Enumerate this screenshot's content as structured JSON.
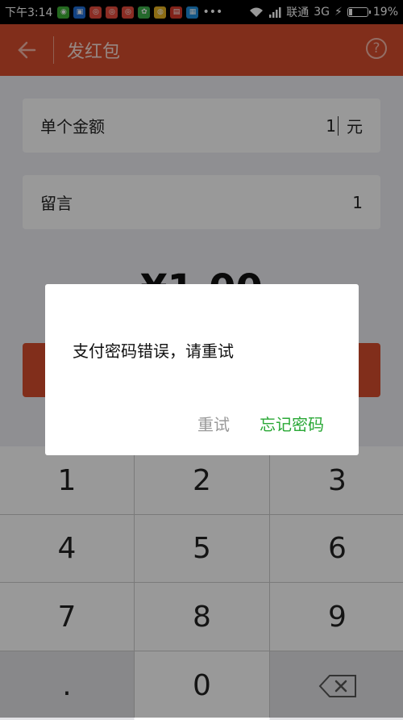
{
  "status_bar": {
    "time": "下午3:14",
    "carrier": "联通",
    "network": "3G",
    "battery": "19%",
    "battery_level": 0.19,
    "dots": "•••",
    "notification_icons": [
      {
        "name": "wechat-icon",
        "color": "#3cb034"
      },
      {
        "name": "app-icon",
        "color": "#1e6fd9"
      },
      {
        "name": "weibo-icon",
        "color": "#e84b3c"
      },
      {
        "name": "weibo-icon",
        "color": "#e84b3c"
      },
      {
        "name": "weibo-icon",
        "color": "#e84b3c"
      },
      {
        "name": "green-app-icon",
        "color": "#3db04a"
      },
      {
        "name": "chrome-icon",
        "color": "#e8b522"
      },
      {
        "name": "news-app-icon",
        "color": "#d83a2b"
      },
      {
        "name": "blue-app-icon",
        "color": "#1e8fe0"
      }
    ]
  },
  "navbar": {
    "title": "发红包",
    "help_glyph": "?",
    "color": "#d84e2d"
  },
  "form": {
    "amount_label": "单个金额",
    "amount_value": "1",
    "amount_unit": "元",
    "message_label": "留言",
    "message_value": "1",
    "total_display": "¥1.00"
  },
  "keypad": {
    "keys": [
      "1",
      "2",
      "3",
      "4",
      "5",
      "6",
      "7",
      "8",
      "9",
      ".",
      "0"
    ],
    "delete_icon": "backspace-icon"
  },
  "dialog": {
    "message": "支付密码错误，请重试",
    "retry_label": "重试",
    "forgot_label": "忘记密码",
    "forgot_color": "#2aa836"
  }
}
